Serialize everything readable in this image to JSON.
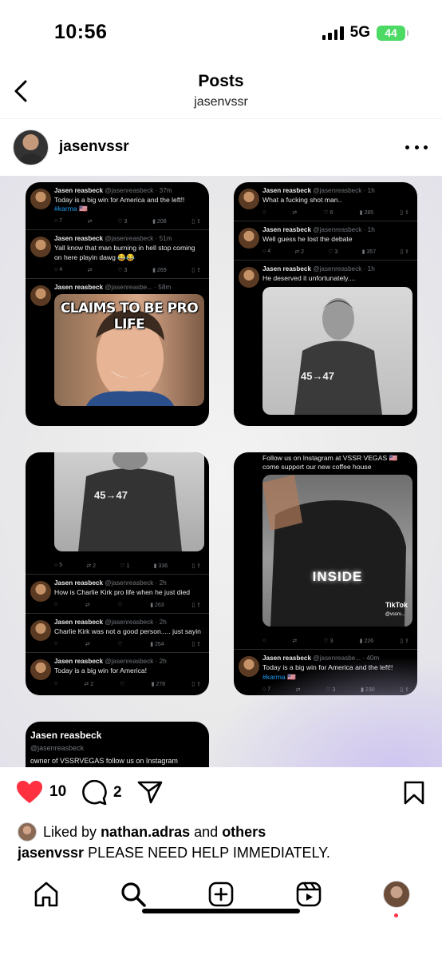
{
  "status_bar": {
    "time": "10:56",
    "network": "5G",
    "battery": "44"
  },
  "header": {
    "title": "Posts",
    "subtitle": "jasenvssr"
  },
  "post": {
    "author": "jasenvssr",
    "likes": "10",
    "comments": "2",
    "liked_by_prefix": "Liked by",
    "liked_by_user": "nathan.adras",
    "liked_by_and": "and",
    "liked_by_others": "others",
    "caption_user": "jasenvssr",
    "caption_text": "PLEASE NEED HELP IMMEDIATELY."
  },
  "screenshots": {
    "card1": {
      "tweets": [
        {
          "name": "Jasen reasbeck",
          "meta": "@jasenreasbeck · 37m",
          "text": "Today is a big win for America and the left!!",
          "tag": "#karma 🇺🇸",
          "stats": [
            "7",
            "",
            "3",
            "208"
          ]
        },
        {
          "name": "Jasen reasbeck",
          "meta": "@jasenreasbeck · 51m",
          "text": "Yall know that man burning in hell stop coming on here playin dawg 😂😂",
          "stats": [
            "4",
            "",
            "3",
            "269"
          ]
        },
        {
          "name": "Jasen reasbeck",
          "meta": "@jasenreasbe... · 58m",
          "text": ""
        }
      ],
      "image_caption": "CLAIMS TO BE PRO LIFE"
    },
    "card2": {
      "tweets": [
        {
          "name": "Jasen reasbeck",
          "meta": "@jasenreasbeck · 1h",
          "text": "What a fucking shot man..",
          "stats": [
            "",
            "",
            "6",
            "285"
          ]
        },
        {
          "name": "Jasen reasbeck",
          "meta": "@jasenreasbeck · 1h",
          "text": "Well guess he lost the debate",
          "stats": [
            "4",
            "2",
            "3",
            "357"
          ]
        },
        {
          "name": "Jasen reasbeck",
          "meta": "@jasenreasbeck · 1h",
          "text": "He deserved it unfortunately...."
        }
      ],
      "hoodie": "45→47"
    },
    "card3": {
      "hoodie": "45→47",
      "first_stats": [
        "5",
        "2",
        "1",
        "336"
      ],
      "tweets": [
        {
          "name": "Jasen reasbeck",
          "meta": "@jasenreasbeck · 2h",
          "text": "How is Charlie Kirk pro life when he just died",
          "stats": [
            "",
            "",
            "",
            "263"
          ]
        },
        {
          "name": "Jasen reasbeck",
          "meta": "@jasenreasbeck · 2h",
          "text": "Charlie Kirk was not a good person..... just sayin",
          "stats": [
            "",
            "",
            "",
            "264"
          ]
        },
        {
          "name": "Jasen reasbeck",
          "meta": "@jasenreasbeck · 2h",
          "text": "Today is a big win for America!",
          "stats": [
            "",
            "2",
            "",
            "278"
          ]
        }
      ]
    },
    "card4": {
      "top_text": "Follow us on Instagram at VSSR VEGAS 🇺🇸 come support our new coffee house",
      "video_caption": "INSIDE",
      "tiktok": "TikTok",
      "tiktok_handle": "@vssrv...",
      "first_stats": [
        "",
        "",
        "3",
        "226"
      ],
      "tweets": [
        {
          "name": "Jasen reasbeck",
          "meta": "@jasenreasbe... · 40m",
          "text": "Today is a big win for America and the left!!",
          "tag": "#karma 🇺🇸",
          "stats": [
            "7",
            "",
            "3",
            "230"
          ]
        }
      ]
    },
    "card5": {
      "title": "Jasen reasbeck",
      "handle": "@jasenreasbeck",
      "bio": "owner of VSSRVEGAS follow us on Instagram"
    }
  },
  "colors": {
    "like": "#ff3040",
    "link": "#1d9bf0",
    "battery": "#4cd964"
  },
  "icons": [
    "back-icon",
    "more-icon",
    "heart-icon",
    "comment-icon",
    "share-icon",
    "bookmark-icon",
    "home-icon",
    "search-icon",
    "create-icon",
    "reels-icon"
  ]
}
